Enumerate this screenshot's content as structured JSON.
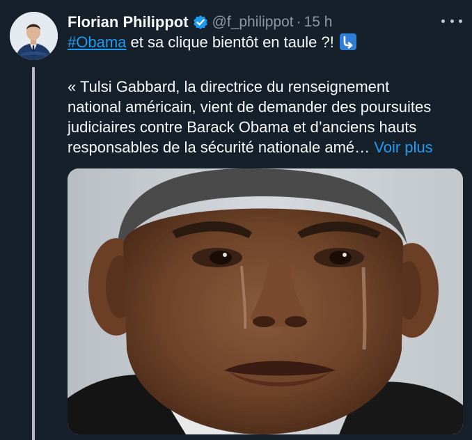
{
  "author": {
    "display_name": "Florian Philippot",
    "handle": "@f_philippot",
    "separator": "·",
    "time": "15 h",
    "verified_icon": "verified-badge-icon",
    "avatar": "profile-photo"
  },
  "tweet": {
    "hashtag": "#Obama",
    "line1_rest": " et sa clique bientôt en taule ?!",
    "emoji": "arrow-down-right-emoji",
    "body_lines": [
      "« Tulsi Gabbard, la directrice du renseignement",
      "national américain, vient de demander des poursuites",
      "judiciaires contre Barack Obama et d’anciens hauts",
      "responsables de la sécurité nationale amé…"
    ],
    "voir_plus": " Voir plus",
    "media": "photo-crying-man-closeup"
  },
  "colors": {
    "background": "#15202b",
    "accent": "#1d9bf0",
    "secondary_text": "#8b98a5"
  }
}
